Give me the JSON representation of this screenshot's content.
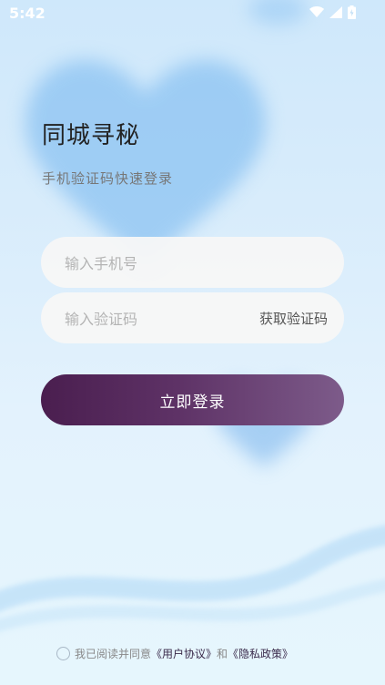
{
  "status_bar": {
    "time": "5:42"
  },
  "header": {
    "title": "同城寻秘",
    "subtitle": "手机验证码快速登录"
  },
  "form": {
    "phone_placeholder": "输入手机号",
    "code_placeholder": "输入验证码",
    "get_code_label": "获取验证码",
    "login_label": "立即登录"
  },
  "agreement": {
    "prefix": "我已阅读并同意",
    "user_agreement": "《用户协议》",
    "and": "和",
    "privacy_policy": "《隐私政策》"
  },
  "colors": {
    "accent_start": "#4a1e4f",
    "accent_end": "#7d5b8a"
  }
}
